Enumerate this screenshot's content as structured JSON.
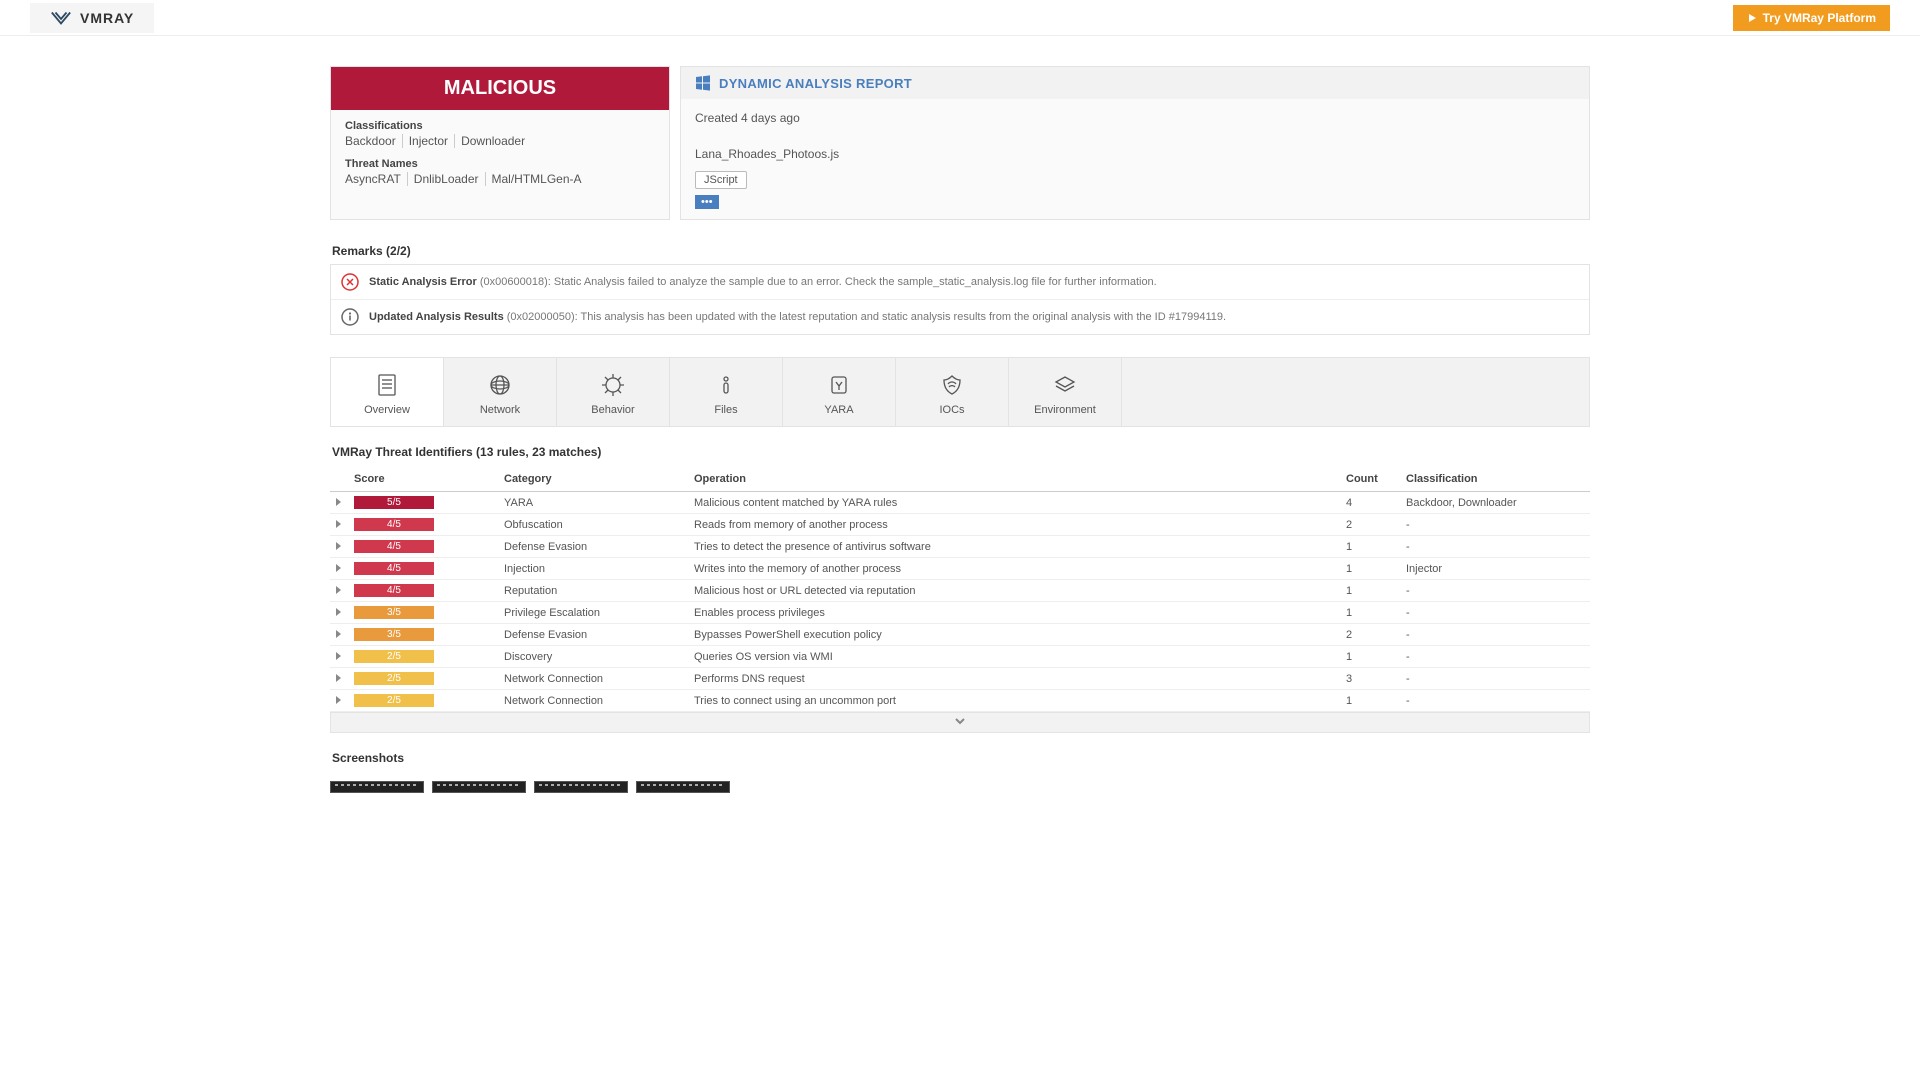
{
  "header": {
    "brand": "VMRAY",
    "cta": "Try VMRay Platform"
  },
  "verdict": {
    "banner": "MALICIOUS",
    "classifications_label": "Classifications",
    "classifications": [
      "Backdoor",
      "Injector",
      "Downloader"
    ],
    "threat_names_label": "Threat Names",
    "threat_names": [
      "AsyncRAT",
      "DnlibLoader",
      "Mal/HTMLGen-A"
    ]
  },
  "report": {
    "title": "DYNAMIC ANALYSIS REPORT",
    "created": "Created 4 days ago",
    "filename": "Lana_Rhoades_Photoos.js",
    "filetype_badge": "JScript",
    "more": "•••"
  },
  "remarks": {
    "heading": "Remarks (2/2)",
    "items": [
      {
        "icon": "error",
        "bold": "Static Analysis Error",
        "text": " (0x00600018): Static Analysis failed to analyze the sample due to an error. Check the sample_static_analysis.log file for further information."
      },
      {
        "icon": "info",
        "bold": "Updated Analysis Results",
        "text": " (0x02000050): This analysis has been updated with the latest reputation and static analysis results from the original analysis with the ID #17994119."
      }
    ]
  },
  "tabs": [
    "Overview",
    "Network",
    "Behavior",
    "Files",
    "YARA",
    "IOCs",
    "Environment"
  ],
  "vti": {
    "title": "VMRay Threat Identifiers (13 rules, 23 matches)",
    "columns": [
      "Score",
      "Category",
      "Operation",
      "Count",
      "Classification"
    ],
    "rows": [
      {
        "score": "5/5",
        "score_cls": "score-55",
        "category": "YARA",
        "operation": "Malicious content matched by YARA rules",
        "count": "4",
        "classification": "Backdoor, Downloader"
      },
      {
        "score": "4/5",
        "score_cls": "score-45",
        "category": "Obfuscation",
        "operation": "Reads from memory of another process",
        "count": "2",
        "classification": "-"
      },
      {
        "score": "4/5",
        "score_cls": "score-45",
        "category": "Defense Evasion",
        "operation": "Tries to detect the presence of antivirus software",
        "count": "1",
        "classification": "-"
      },
      {
        "score": "4/5",
        "score_cls": "score-45",
        "category": "Injection",
        "operation": "Writes into the memory of another process",
        "count": "1",
        "classification": "Injector"
      },
      {
        "score": "4/5",
        "score_cls": "score-45",
        "category": "Reputation",
        "operation": "Malicious host or URL detected via reputation",
        "count": "1",
        "classification": "-"
      },
      {
        "score": "3/5",
        "score_cls": "score-35",
        "category": "Privilege Escalation",
        "operation": "Enables process privileges",
        "count": "1",
        "classification": "-"
      },
      {
        "score": "3/5",
        "score_cls": "score-35",
        "category": "Defense Evasion",
        "operation": "Bypasses PowerShell execution policy",
        "count": "2",
        "classification": "-"
      },
      {
        "score": "2/5",
        "score_cls": "score-25",
        "category": "Discovery",
        "operation": "Queries OS version via WMI",
        "count": "1",
        "classification": "-"
      },
      {
        "score": "2/5",
        "score_cls": "score-25",
        "category": "Network Connection",
        "operation": "Performs DNS request",
        "count": "3",
        "classification": "-"
      },
      {
        "score": "2/5",
        "score_cls": "score-25",
        "category": "Network Connection",
        "operation": "Tries to connect using an uncommon port",
        "count": "1",
        "classification": "-"
      }
    ]
  },
  "screenshots": {
    "title": "Screenshots"
  }
}
